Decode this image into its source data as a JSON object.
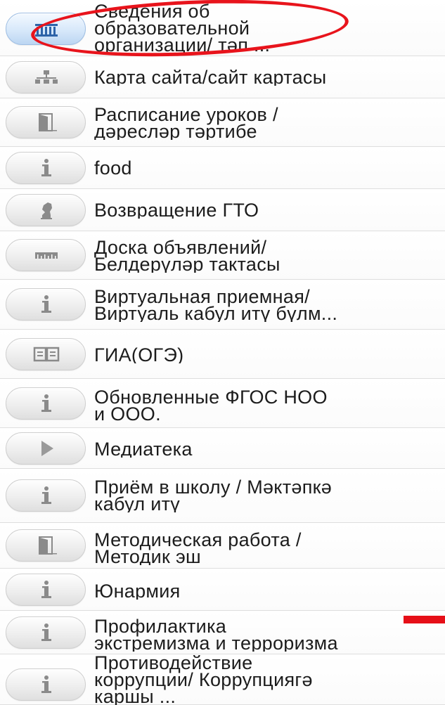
{
  "menu": {
    "items": [
      {
        "lines": [
          "Сведения об",
          "образовательной",
          "организации/ тәп ..."
        ],
        "icon": "building-icon",
        "active": true
      },
      {
        "lines": [
          "Карта сайта/сайт картасы"
        ],
        "icon": "sitemap-icon",
        "active": false
      },
      {
        "lines": [
          "Расписание уроков /",
          "дәресләр тәртибе"
        ],
        "icon": "door-icon",
        "active": false
      },
      {
        "lines": [
          "food"
        ],
        "icon": "info-icon",
        "active": false
      },
      {
        "lines": [
          "Возвращение ГТО"
        ],
        "icon": "chess-knight-icon",
        "active": false
      },
      {
        "lines": [
          "Доска объявлений/",
          "Белдерүләр тактасы"
        ],
        "icon": "ruler-icon",
        "active": false
      },
      {
        "lines": [
          "Виртуальная приемная/",
          "Виртуаль кабул итү бүлм..."
        ],
        "icon": "info-icon",
        "active": false
      },
      {
        "lines": [
          "ГИА(ОГЭ)"
        ],
        "icon": "book-icon",
        "active": false
      },
      {
        "lines": [
          "Обновленные ФГОС НОО",
          "и ООО."
        ],
        "icon": "info-icon",
        "active": false
      },
      {
        "lines": [
          "Медиатека"
        ],
        "icon": "play-icon",
        "active": false
      },
      {
        "lines": [
          "Приём в школу / Мәктәпкә",
          "кабул итү"
        ],
        "icon": "info-icon",
        "active": false
      },
      {
        "lines": [
          "Методическая работа /",
          "Методик эш"
        ],
        "icon": "door-icon",
        "active": false
      },
      {
        "lines": [
          "Юнармия"
        ],
        "icon": "info-icon",
        "active": false
      },
      {
        "lines": [
          "Профилактика",
          "экстремизма и терроризма"
        ],
        "icon": "info-icon",
        "active": false
      },
      {
        "lines": [
          "Противодействие",
          "коррупции/ Коррупциягә",
          "каршы ..."
        ],
        "icon": "info-icon",
        "active": false
      }
    ]
  },
  "annotations": {
    "highlight_color": "#e8141c",
    "marker_color": "#e60f18"
  }
}
